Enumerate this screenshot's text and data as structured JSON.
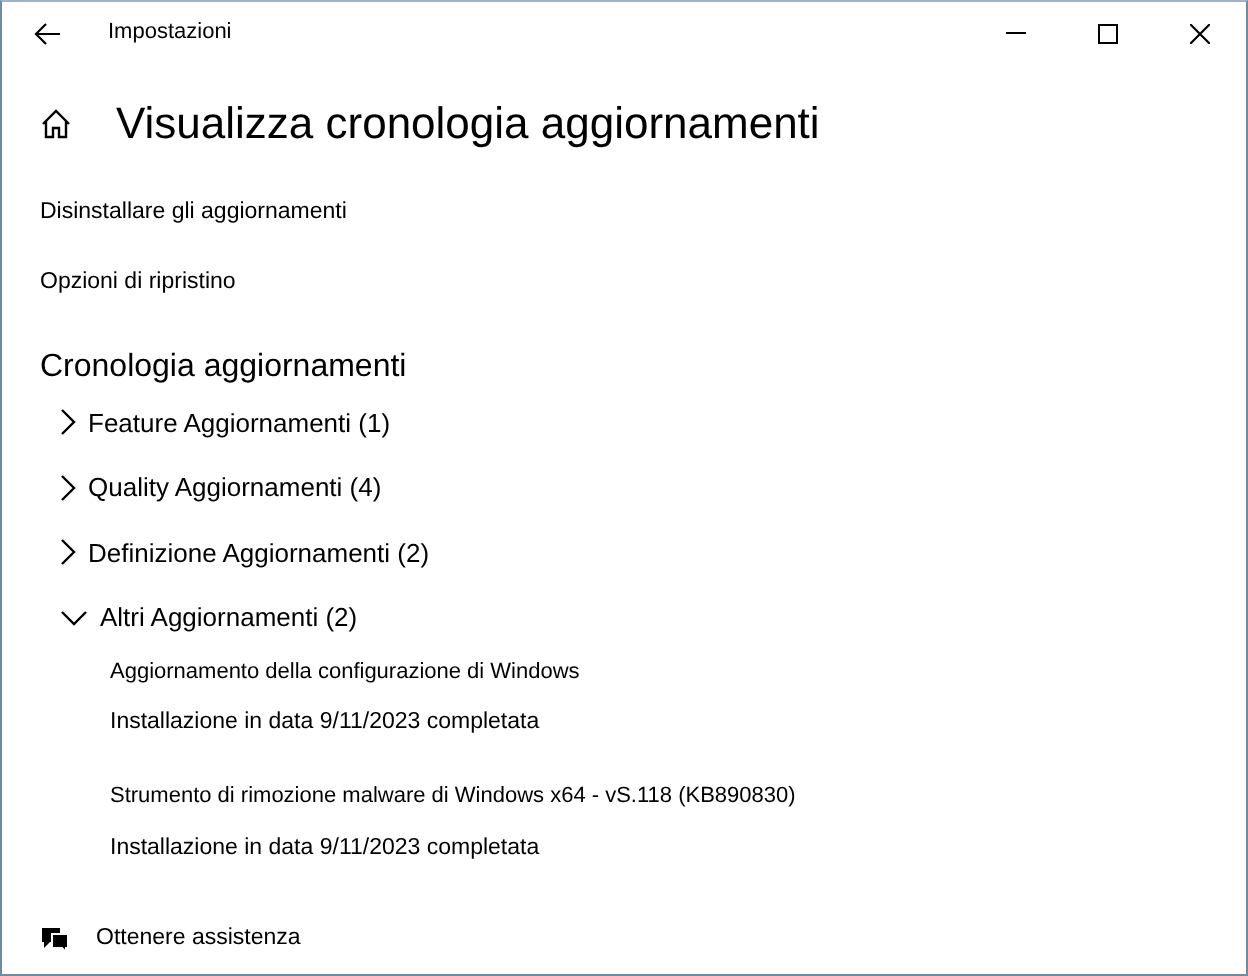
{
  "window": {
    "title": "Impostazioni"
  },
  "page_title": "Visualizza cronologia aggiornamenti",
  "links": [
    "Disinstallare gli aggiornamenti",
    "Opzioni di ripristino"
  ],
  "section_title": "Cronologia aggiornamenti",
  "groups": [
    {
      "label": "Feature Aggiornamenti (1)",
      "expanded": false
    },
    {
      "label": "Quality Aggiornamenti (4)",
      "expanded": false
    },
    {
      "label": "Definizione Aggiornamenti (2)",
      "expanded": false
    },
    {
      "label": "Altri Aggiornamenti (2)",
      "expanded": true,
      "entries": [
        {
          "name": "Aggiornamento della configurazione di Windows",
          "status": "Installazione in data 9/11/2023 completata"
        },
        {
          "name": "Strumento di rimozione malware di Windows x64 - vS.118 (KB890830)",
          "status": "Installazione in data 9/11/2023 completata"
        }
      ]
    }
  ],
  "help": "Ottenere assistenza"
}
